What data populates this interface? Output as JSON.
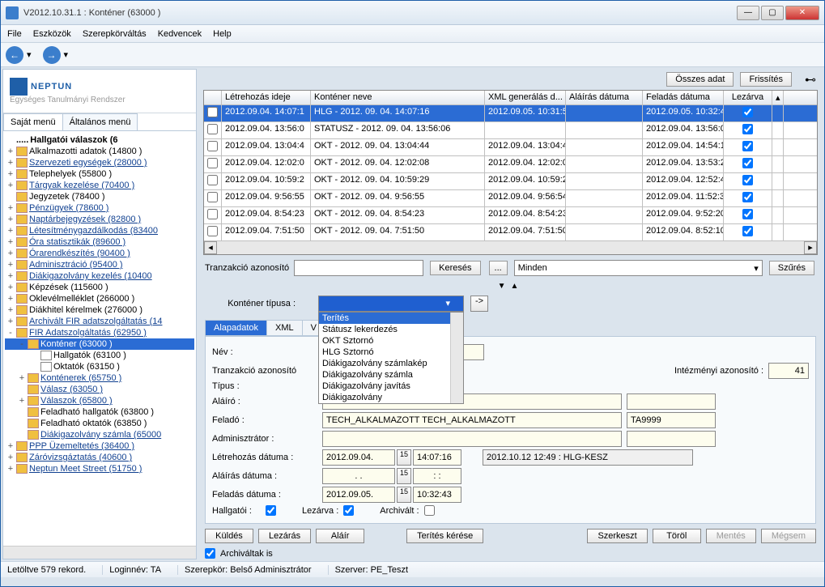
{
  "window": {
    "title": "V2012.10.31.1 : Konténer (63000  )"
  },
  "menu": {
    "file": "File",
    "tools": "Eszközök",
    "roleswitch": "Szerepkörváltás",
    "fav": "Kedvencek",
    "help": "Help"
  },
  "toolbar": {
    "all_data": "Összes adat",
    "refresh": "Frissítés"
  },
  "logo": {
    "main": "NEPTUN",
    "sub": "Egységes Tanulmányi Rendszer"
  },
  "tabs": {
    "own": "Saját menü",
    "general": "Általános menü"
  },
  "tree": {
    "header": "Hallgatói válaszok (6",
    "items": [
      {
        "pre": "+",
        "text": "Alkalmazotti adatok (14800  )",
        "link": false
      },
      {
        "pre": "+",
        "text": "Szervezeti egységek  (28000  )",
        "link": true
      },
      {
        "pre": "+",
        "text": "Telephelyek (55800  )",
        "link": false
      },
      {
        "pre": "+",
        "text": "Tárgyak kezelése (70400  )",
        "link": true
      },
      {
        "pre": "",
        "text": "Jegyzetek (78400  )",
        "link": false
      },
      {
        "pre": "+",
        "text": "Pénzügyek (78600  )",
        "link": true
      },
      {
        "pre": "+",
        "text": "Naptárbejegyzések (82800  )",
        "link": true
      },
      {
        "pre": "+",
        "text": "Létesítménygazdálkodás (83400",
        "link": true
      },
      {
        "pre": "+",
        "text": "Óra statisztikák (89600  )",
        "link": true
      },
      {
        "pre": "+",
        "text": "Órarendkészítés (90400  )",
        "link": true
      },
      {
        "pre": "+",
        "text": "Adminisztráció (95400  )",
        "link": true
      },
      {
        "pre": "+",
        "text": "Diákigazolvány kezelés (10400",
        "link": true
      },
      {
        "pre": "+",
        "text": "Képzések (115600  )",
        "link": false
      },
      {
        "pre": "+",
        "text": "Oklevélmelléklet (266000  )",
        "link": false
      },
      {
        "pre": "+",
        "text": "Diákhitel kérelmek (276000  )",
        "link": false
      },
      {
        "pre": "+",
        "text": "Archivált FIR adatszolgáltatás (14",
        "link": true
      },
      {
        "pre": "-",
        "text": "FIR Adatszolgáltatás (62950  )",
        "link": true
      }
    ],
    "selected": "Konténer (63000  )",
    "sub": [
      {
        "pre": "",
        "text": "Hallgatók (63100  )",
        "indent": 2,
        "doc": true
      },
      {
        "pre": "",
        "text": "Oktatók (63150  )",
        "indent": 2,
        "doc": true
      },
      {
        "pre": "+",
        "text": "Konténerek (65750  )",
        "indent": 1,
        "link": true
      },
      {
        "pre": "",
        "text": "Válasz (63050  )",
        "indent": 1,
        "link": true
      },
      {
        "pre": "+",
        "text": "Válaszok (65800  )",
        "indent": 1,
        "link": true
      },
      {
        "pre": "",
        "text": "Feladható hallgatók (63800  )",
        "indent": 1
      },
      {
        "pre": "",
        "text": "Feladható oktatók (63850  )",
        "indent": 1
      },
      {
        "pre": "",
        "text": "Diákigazolvány számla (65000",
        "indent": 1,
        "link": true
      }
    ],
    "after": [
      {
        "pre": "+",
        "text": "PPP Üzemeltetés (36400  )",
        "link": true
      },
      {
        "pre": "+",
        "text": "Záróvizsgáztatás (40600  )",
        "link": true
      },
      {
        "pre": "+",
        "text": "Neptun Meet Street (51750  )",
        "link": true
      }
    ]
  },
  "grid": {
    "cols": [
      "Létrehozás ideje",
      "Konténer neve",
      "XML generálás d...",
      "Aláírás dátuma",
      "Feladás dátuma",
      "Lezárva"
    ],
    "rows": [
      {
        "t": "2012.09.04. 14:07:1",
        "n": "HLG - 2012. 09. 04. 14:07:16",
        "x": "2012.09.05. 10:31:5",
        "a": "",
        "f": "2012.09.05. 10:32:4",
        "c": true,
        "sel": true
      },
      {
        "t": "2012.09.04. 13:56:0",
        "n": "STATUSZ - 2012. 09. 04. 13:56:06",
        "x": "",
        "a": "",
        "f": "2012.09.04. 13:56:0",
        "c": true
      },
      {
        "t": "2012.09.04. 13:04:4",
        "n": "OKT - 2012. 09. 04. 13:04:44",
        "x": "2012.09.04. 13:04:4",
        "a": "",
        "f": "2012.09.04. 14:54:1",
        "c": true
      },
      {
        "t": "2012.09.04. 12:02:0",
        "n": "OKT - 2012. 09. 04. 12:02:08",
        "x": "2012.09.04. 12:02:0",
        "a": "",
        "f": "2012.09.04. 13:53:2",
        "c": true
      },
      {
        "t": "2012.09.04. 10:59:2",
        "n": "OKT - 2012. 09. 04. 10:59:29",
        "x": "2012.09.04. 10:59:2",
        "a": "",
        "f": "2012.09.04. 12:52:4",
        "c": true
      },
      {
        "t": "2012.09.04. 9:56:55",
        "n": "OKT - 2012. 09. 04. 9:56:55",
        "x": "2012.09.04. 9:56:54",
        "a": "",
        "f": "2012.09.04. 11:52:3",
        "c": true
      },
      {
        "t": "2012.09.04. 8:54:23",
        "n": "OKT - 2012. 09. 04. 8:54:23",
        "x": "2012.09.04. 8:54:23",
        "a": "",
        "f": "2012.09.04. 9:52:20",
        "c": true
      },
      {
        "t": "2012.09.04. 7:51:50",
        "n": "OKT - 2012. 09. 04. 7:51:50",
        "x": "2012.09.04. 7:51:50",
        "a": "",
        "f": "2012.09.04. 8:52:10",
        "c": true
      }
    ]
  },
  "search": {
    "label": "Tranzakció azonosító",
    "btn_search": "Keresés",
    "btn_dots": "...",
    "filter_all": "Minden",
    "btn_filter": "Szűrés"
  },
  "type": {
    "label": "Konténer típusa :",
    "value": "",
    "options": [
      "Terítés",
      "Státusz lekerdezés",
      "OKT Sztornó",
      "HLG Sztornó",
      "Diákigazolvány számlakép",
      "Diákigazolvány számla",
      "Diákigazolvány javítás",
      "Diákigazolvány"
    ]
  },
  "formtabs": {
    "t1": "Alapadatok",
    "t2": "XML",
    "t3": "V"
  },
  "form": {
    "name_l": "Név :",
    "txid_l": "Tranzakció azonosító",
    "type_l": "Típus :",
    "signer_l": "Aláíró :",
    "sender_l": "Feladó :",
    "admin_l": "Adminisztrátor :",
    "created_l": "Létrehozás dátuma :",
    "signed_l": "Aláírás dátuma :",
    "sent_l": "Feladás dátuma :",
    "student_l": "Hallgatói :",
    "closed_l": "Lezárva :",
    "archived_l": "Archivált :",
    "inst_id_l": "Intézményi azonosító :",
    "inst_id_v": "41",
    "sender_v": "TECH_ALKALMAZOTT TECH_ALKALMAZOTT",
    "sender_code": "TA9999",
    "created_d": "2012.09.04.",
    "created_t": "14:07:16",
    "signed_d": ". .",
    "signed_t": ": :",
    "sent_d": "2012.09.05.",
    "sent_t": "10:32:43",
    "note": "2012.10.12 12:49 : HLG-KESZ"
  },
  "buttons": {
    "send": "Küldés",
    "close": "Lezárás",
    "sign": "Aláír",
    "spread": "Terítés kérése",
    "edit": "Szerkeszt",
    "delete": "Töröl",
    "save": "Mentés",
    "cancel": "Mégsem",
    "archived_too": "Archiváltak is"
  },
  "status": {
    "loaded": "Letöltve 579 rekord.",
    "login": "Loginnév: TA",
    "role": "Szerepkör: Belső Adminisztrátor",
    "server": "Szerver: PE_Teszt"
  }
}
